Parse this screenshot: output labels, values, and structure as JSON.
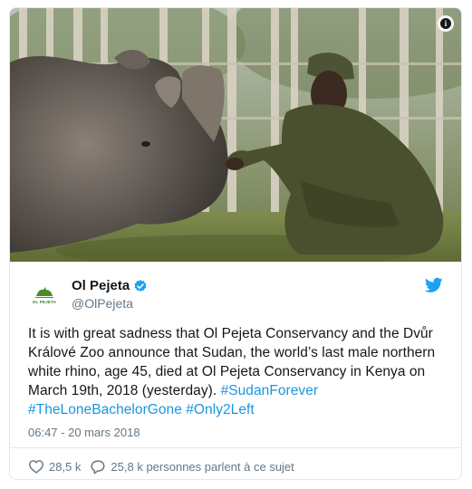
{
  "tweet": {
    "display_name": "Ol Pejeta",
    "handle": "@OlPejeta",
    "logo_text": "OL PEJETA",
    "text_plain": "It is with great sadness that Ol Pejeta Conservancy and the Dvůr Králové Zoo announce that Sudan, the world’s last male northern white rhino, age 45, died at Ol Pejeta Conservancy in Kenya on March 19th, 2018 (yesterday).  ",
    "hashtag_1": "#SudanForever",
    "hashtag_2": "#TheLoneBachelorGone",
    "hashtag_3": "#Only2Left",
    "timestamp": "06:47 - 20 mars 2018"
  },
  "actions": {
    "likes": "28,5 k",
    "talking": "25,8 k personnes parlent à ce sujet"
  },
  "colors": {
    "link": "#1b95e0",
    "muted": "#657786",
    "border": "#e1e8ed",
    "twitter_blue": "#1da1f2"
  },
  "icons": [
    "info-icon",
    "verified-badge-icon",
    "twitter-bird-icon",
    "heart-icon",
    "comment-icon"
  ]
}
